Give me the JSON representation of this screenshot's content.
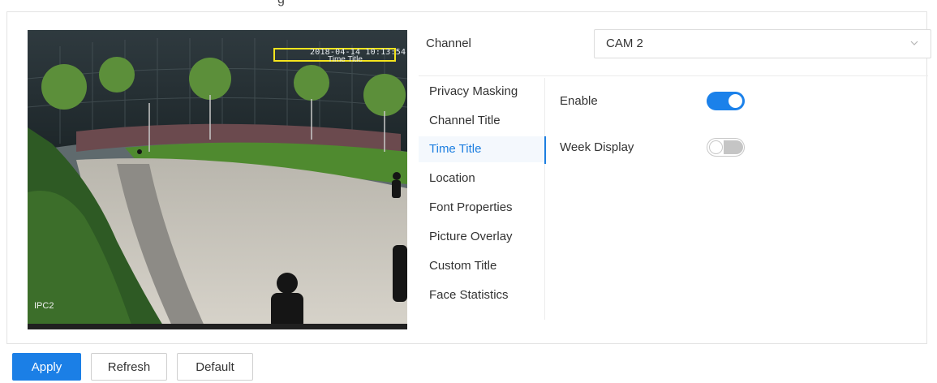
{
  "video": {
    "osd_time": "2018-04-14 10:13:54",
    "osd_time_label": "Time Title",
    "osd_channel": "IPC2"
  },
  "channel": {
    "label": "Channel",
    "selected": "CAM 2"
  },
  "menu": {
    "items": [
      {
        "label": "Privacy Masking"
      },
      {
        "label": "Channel Title"
      },
      {
        "label": "Time Title"
      },
      {
        "label": "Location"
      },
      {
        "label": "Font Properties"
      },
      {
        "label": "Picture Overlay"
      },
      {
        "label": "Custom Title"
      },
      {
        "label": "Face Statistics"
      }
    ],
    "active": "Time Title"
  },
  "settings": {
    "enable_label": "Enable",
    "enable_on": true,
    "week_display_label": "Week Display",
    "week_display_on": false
  },
  "buttons": {
    "apply": "Apply",
    "refresh": "Refresh",
    "default": "Default"
  },
  "colors": {
    "accent": "#1b7fe6",
    "osd_box": "#f5e51d"
  },
  "icons": {
    "dropdown": "chevron-down-icon"
  }
}
